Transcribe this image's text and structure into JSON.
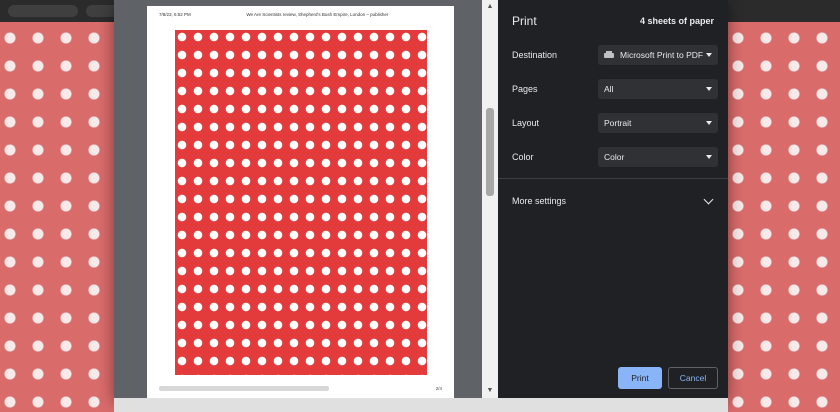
{
  "preview": {
    "header_left": "7/8/23, 6:52 PM",
    "header_center": "We Are Scientists review, Shepherd's Bush Empire, London – publisher",
    "page_number": "2/4"
  },
  "print_panel": {
    "title": "Print",
    "sheets": "4 sheets of paper",
    "destination": {
      "label": "Destination",
      "value": "Microsoft Print to PDF"
    },
    "pages": {
      "label": "Pages",
      "value": "All"
    },
    "layout": {
      "label": "Layout",
      "value": "Portrait"
    },
    "color": {
      "label": "Color",
      "value": "Color"
    },
    "more_settings": "More settings",
    "print_button": "Print",
    "cancel_button": "Cancel"
  },
  "colors": {
    "panel_bg": "#202124",
    "accent": "#8ab4f8",
    "page_pattern": "#e33b3b",
    "background_pattern": "#d96b6b"
  }
}
